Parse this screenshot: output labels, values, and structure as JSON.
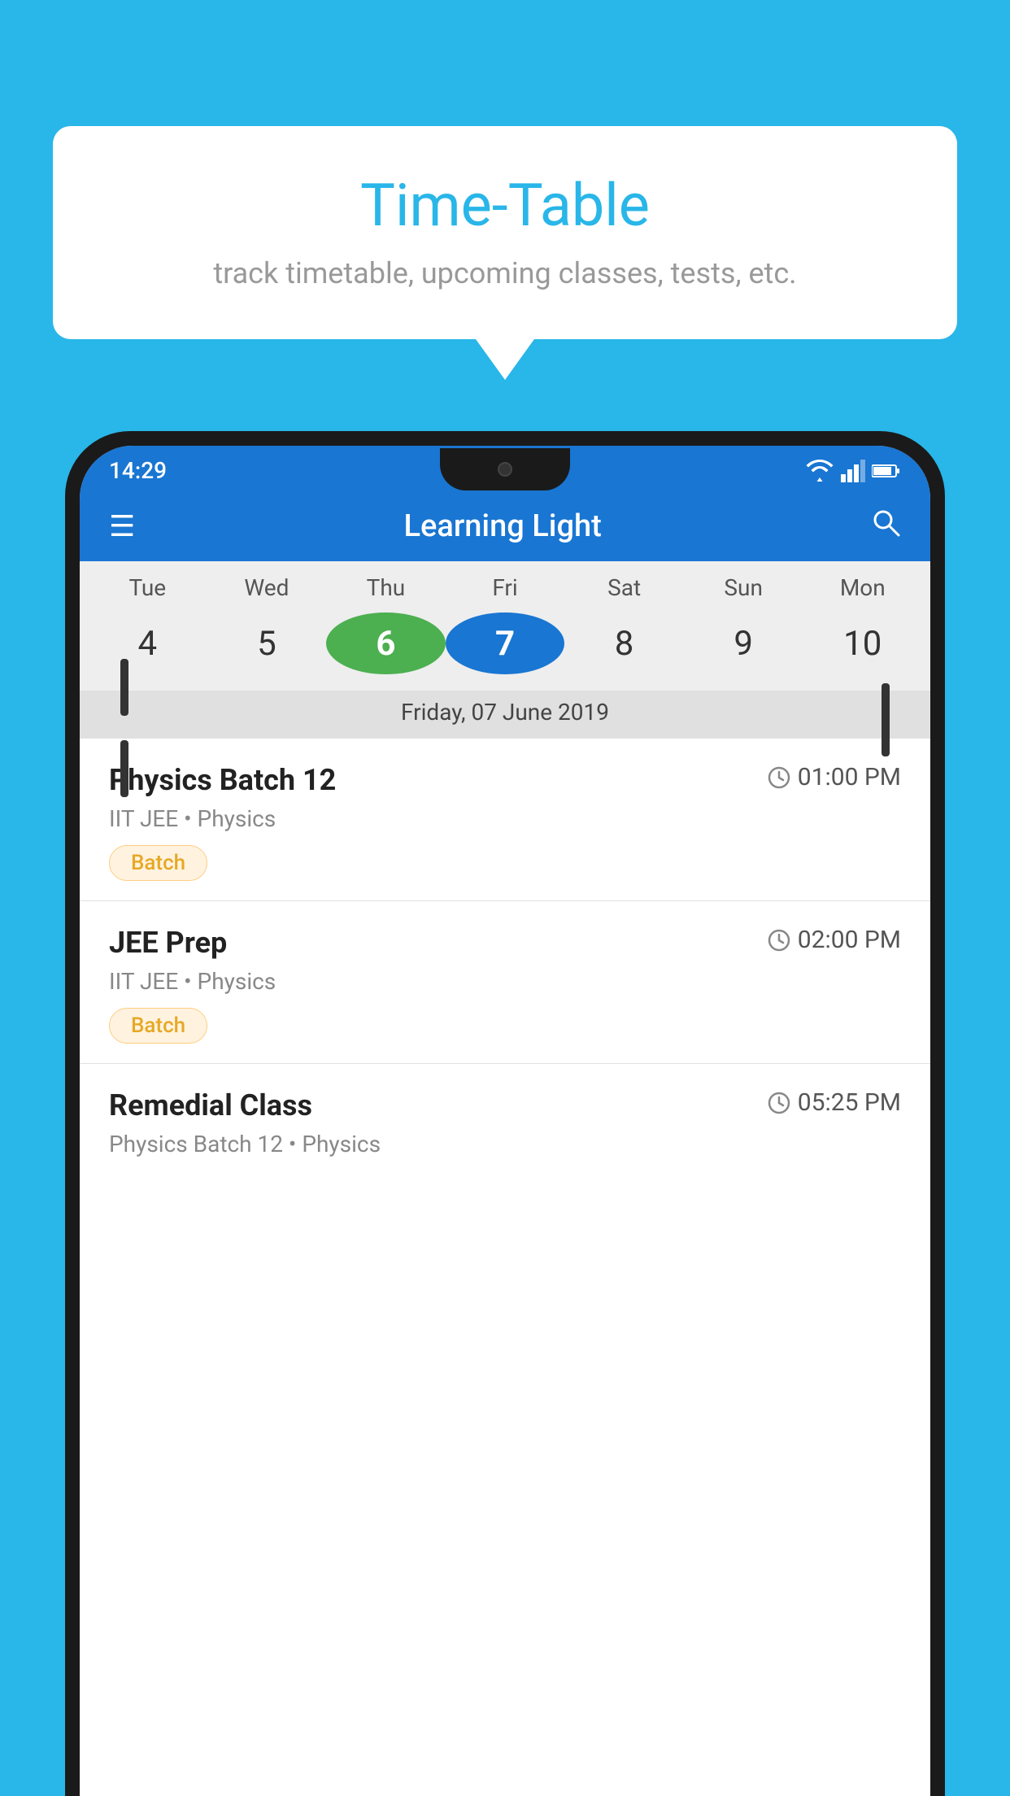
{
  "background_color": "#29b6e8",
  "speech_bubble": {
    "title": "Time-Table",
    "subtitle": "track timetable, upcoming classes, tests, etc."
  },
  "phone": {
    "status_bar": {
      "time": "14:29",
      "icons": [
        "wifi",
        "signal",
        "battery"
      ]
    },
    "app_bar": {
      "title": "Learning Light",
      "menu_icon": "☰",
      "search_icon": "🔍"
    },
    "calendar": {
      "days": [
        {
          "name": "Tue",
          "number": "4",
          "state": "normal"
        },
        {
          "name": "Wed",
          "number": "5",
          "state": "normal"
        },
        {
          "name": "Thu",
          "number": "6",
          "state": "today"
        },
        {
          "name": "Fri",
          "number": "7",
          "state": "selected"
        },
        {
          "name": "Sat",
          "number": "8",
          "state": "normal"
        },
        {
          "name": "Sun",
          "number": "9",
          "state": "normal"
        },
        {
          "name": "Mon",
          "number": "10",
          "state": "normal"
        }
      ],
      "selected_date_label": "Friday, 07 June 2019"
    },
    "schedule": [
      {
        "title": "Physics Batch 12",
        "time": "01:00 PM",
        "sub": "IIT JEE • Physics",
        "badge": "Batch"
      },
      {
        "title": "JEE Prep",
        "time": "02:00 PM",
        "sub": "IIT JEE • Physics",
        "badge": "Batch"
      },
      {
        "title": "Remedial Class",
        "time": "05:25 PM",
        "sub": "Physics Batch 12 • Physics",
        "badge": ""
      }
    ]
  }
}
